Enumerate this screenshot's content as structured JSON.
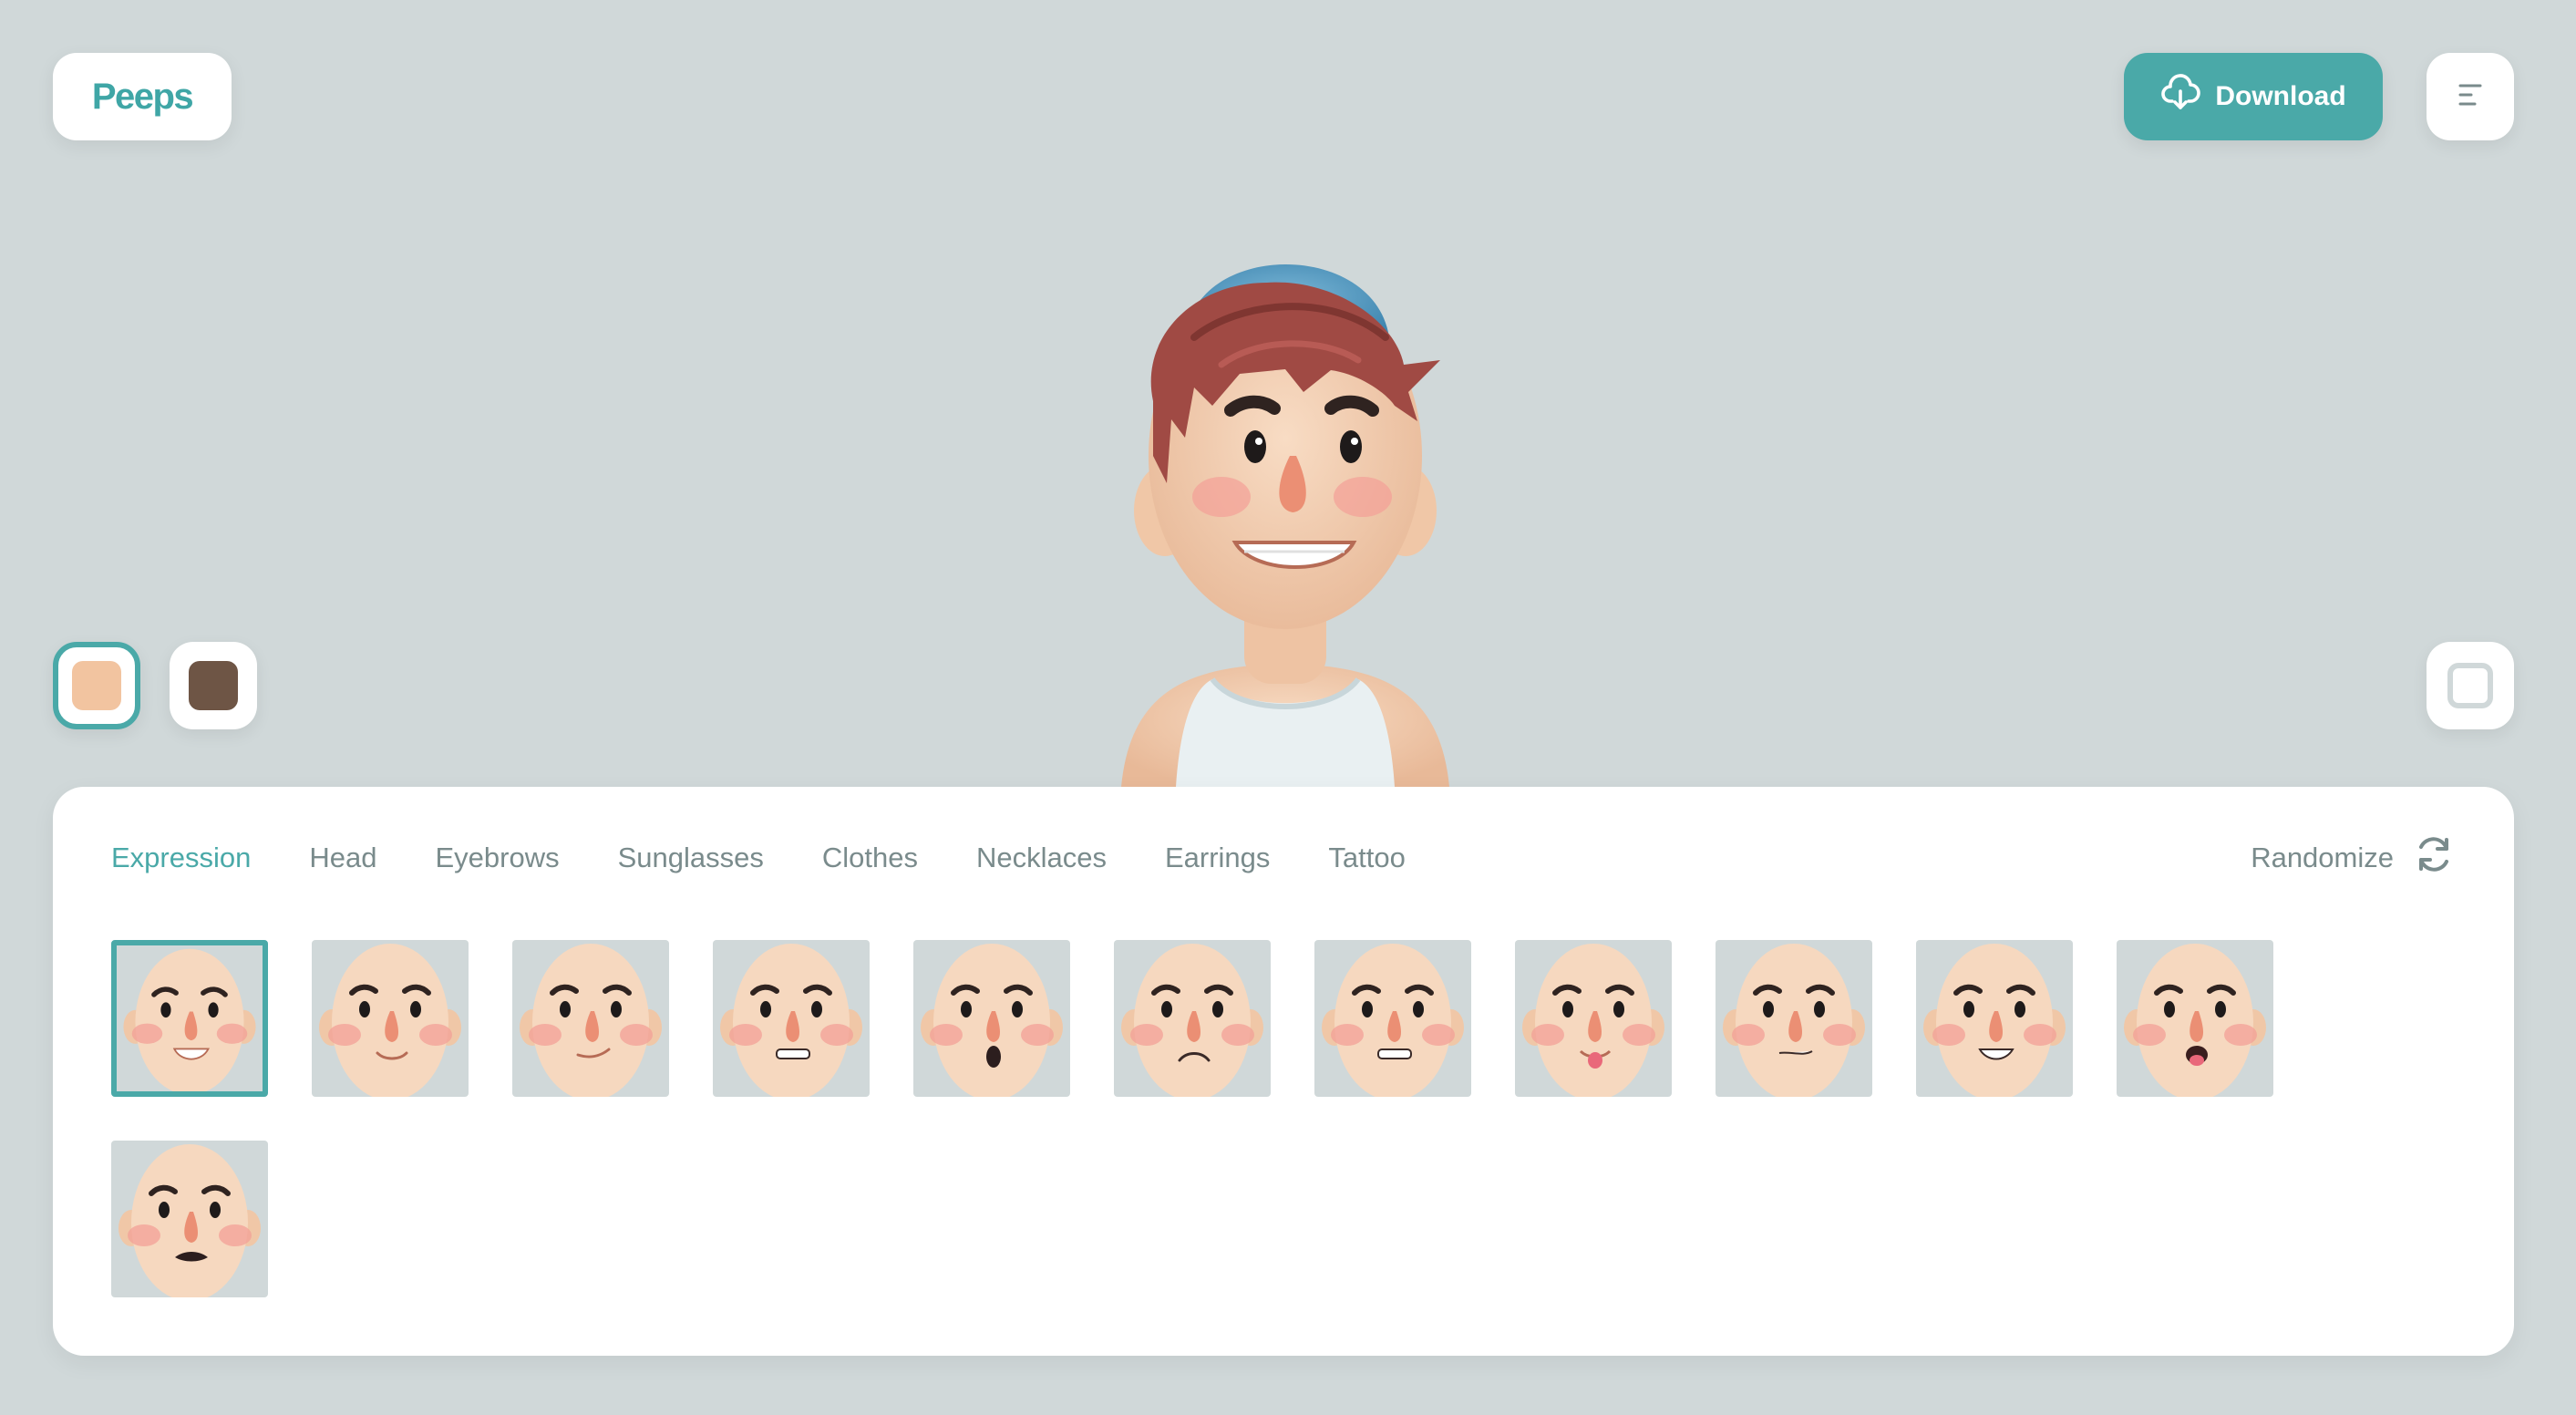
{
  "app": {
    "logo_text": "Peeps"
  },
  "header": {
    "download_label": "Download",
    "download_icon": "cloud-download-icon",
    "menu_icon": "menu-icon"
  },
  "skin_tones": [
    {
      "color": "#f2c4a0",
      "selected": true
    },
    {
      "color": "#6e5545",
      "selected": false
    }
  ],
  "background_toggle": {
    "icon": "square-icon"
  },
  "colors": {
    "accent": "#4aa9a8",
    "background": "#d0d8d9",
    "panel": "#ffffff",
    "tab_text": "#7a8b8c"
  },
  "tabs": [
    {
      "label": "Expression",
      "active": true
    },
    {
      "label": "Head",
      "active": false
    },
    {
      "label": "Eyebrows",
      "active": false
    },
    {
      "label": "Sunglasses",
      "active": false
    },
    {
      "label": "Clothes",
      "active": false
    },
    {
      "label": "Necklaces",
      "active": false
    },
    {
      "label": "Earrings",
      "active": false
    },
    {
      "label": "Tattoo",
      "active": false
    }
  ],
  "randomize": {
    "label": "Randomize",
    "icon": "refresh-icon"
  },
  "expressions": [
    {
      "mouth": "big-smile",
      "selected": true
    },
    {
      "mouth": "smile",
      "selected": false
    },
    {
      "mouth": "smirk",
      "selected": false
    },
    {
      "mouth": "grimace",
      "selected": false
    },
    {
      "mouth": "surprised",
      "selected": false
    },
    {
      "mouth": "sad",
      "selected": false
    },
    {
      "mouth": "teeth",
      "selected": false
    },
    {
      "mouth": "tongue",
      "selected": false
    },
    {
      "mouth": "lopsided",
      "selected": false
    },
    {
      "mouth": "grin",
      "selected": false
    },
    {
      "mouth": "open-tongue",
      "selected": false
    },
    {
      "mouth": "worried",
      "selected": false
    }
  ]
}
